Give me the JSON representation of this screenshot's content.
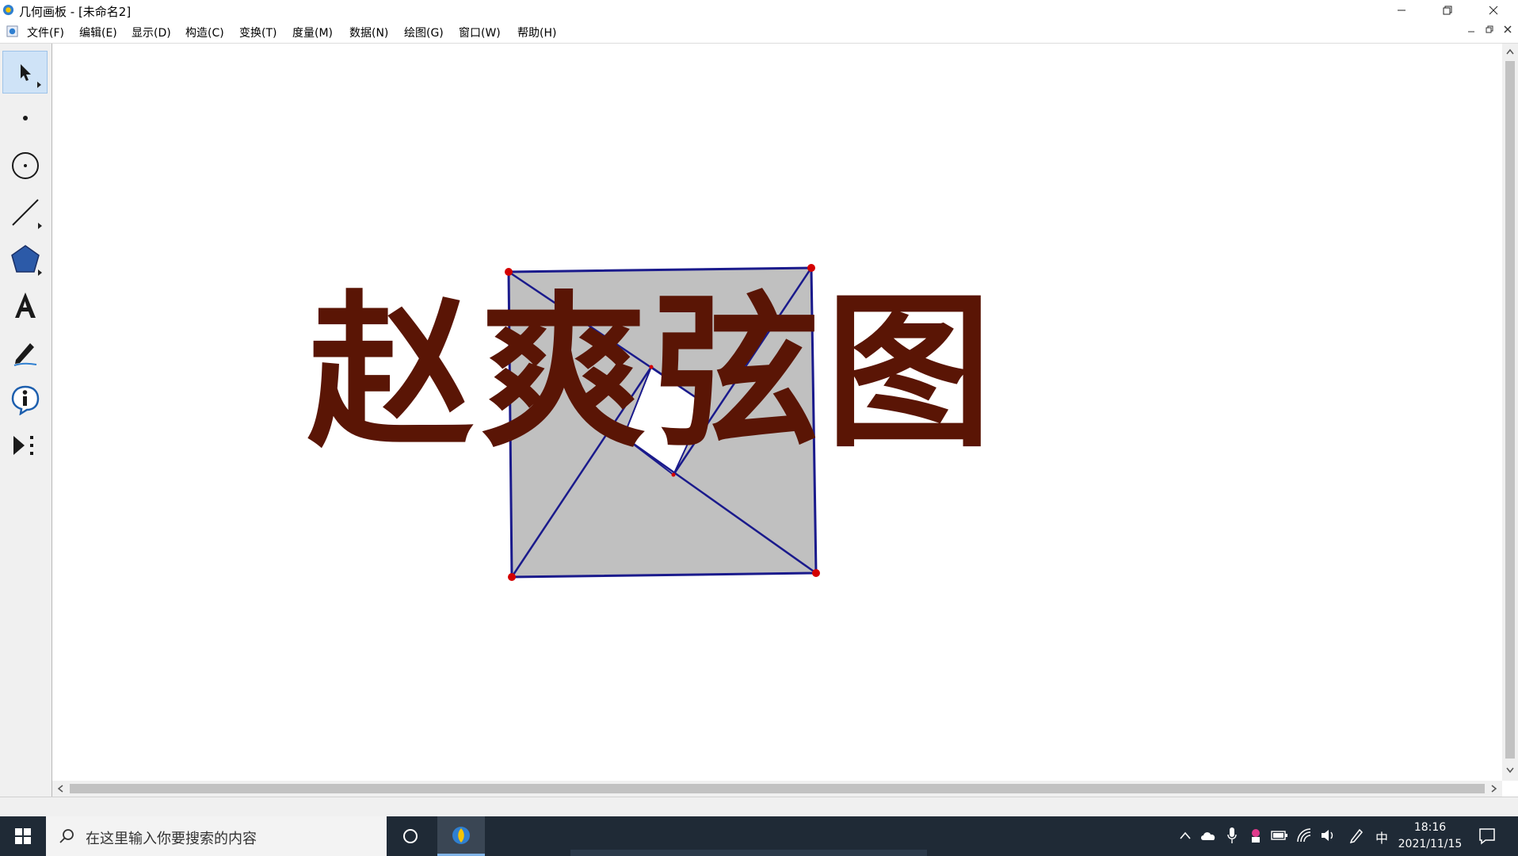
{
  "window": {
    "title": "几何画板 - [未命名2]"
  },
  "menubar": {
    "items": [
      "文件(F)",
      "编辑(E)",
      "显示(D)",
      "构造(C)",
      "变换(T)",
      "度量(M)",
      "数据(N)",
      "绘图(G)",
      "窗口(W)",
      "帮助(H)"
    ]
  },
  "toolbar": {
    "tools": [
      "arrow-select",
      "point",
      "compass",
      "straightedge",
      "polygon",
      "text",
      "marker",
      "information",
      "custom"
    ]
  },
  "canvas": {
    "headline": "赵爽弦图",
    "colors": {
      "fill": "#c0c0c0",
      "stroke": "#1a1a8c",
      "point": "#d40000",
      "text": "#5a1505"
    }
  },
  "taskbar": {
    "search_placeholder": "在这里输入你要搜索的内容",
    "ime": "中",
    "time": "18:16",
    "date": "2021/11/15"
  }
}
